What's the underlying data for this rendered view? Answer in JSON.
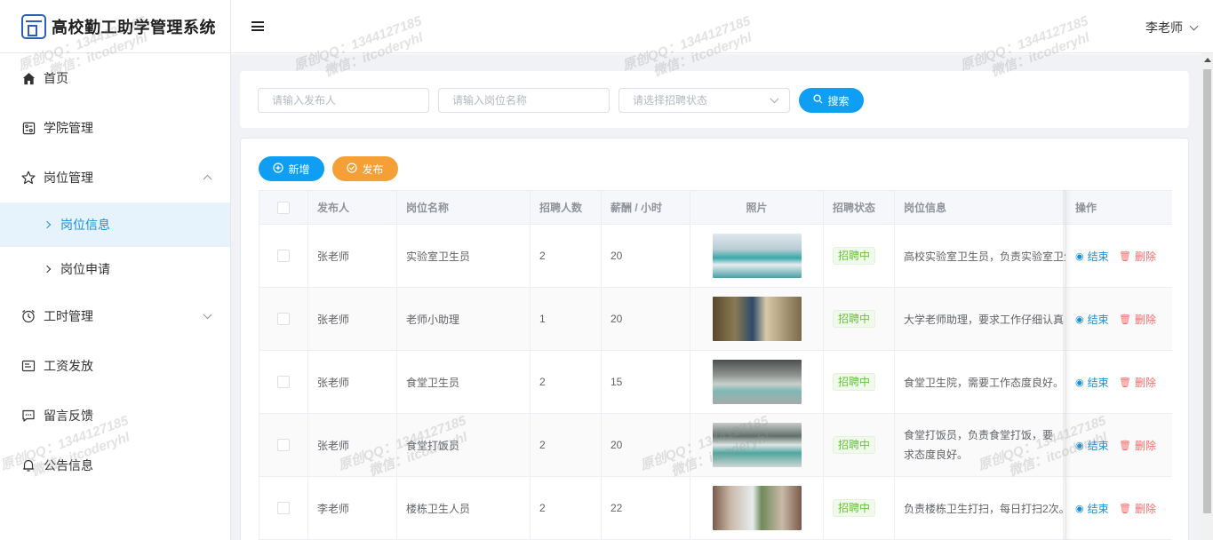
{
  "app": {
    "title": "高校勤工助学管理系统"
  },
  "header": {
    "user": "李老师"
  },
  "sidebar": {
    "items": [
      {
        "label": "首页",
        "icon": "home-icon"
      },
      {
        "label": "学院管理",
        "icon": "college-icon"
      },
      {
        "label": "岗位管理",
        "icon": "star-icon",
        "expanded": true,
        "children": [
          {
            "label": "岗位信息",
            "active": true
          },
          {
            "label": "岗位申请"
          }
        ]
      },
      {
        "label": "工时管理",
        "icon": "clock-icon",
        "expanded": false
      },
      {
        "label": "工资发放",
        "icon": "card-icon"
      },
      {
        "label": "留言反馈",
        "icon": "message-icon"
      },
      {
        "label": "公告信息",
        "icon": "bell-icon"
      }
    ]
  },
  "search": {
    "publisher_placeholder": "请输入发布人",
    "job_placeholder": "请输入岗位名称",
    "status_placeholder": "请选择招聘状态",
    "search_label": "搜索"
  },
  "toolbar": {
    "add_label": "新增",
    "publish_label": "发布"
  },
  "table": {
    "columns": [
      "发布人",
      "岗位名称",
      "招聘人数",
      "薪酬 / 小时",
      "照片",
      "招聘状态",
      "岗位信息",
      "操作"
    ],
    "actions": {
      "end": "结束",
      "delete": "删除"
    },
    "rows": [
      {
        "publisher": "张老师",
        "job": "实验室卫生员",
        "count": "2",
        "pay": "20",
        "status": "招聘中",
        "info": "高校实验室卫生员，负责实验室卫生",
        "photo": "lab-photo"
      },
      {
        "publisher": "张老师",
        "job": "老师小助理",
        "count": "1",
        "pay": "20",
        "status": "招聘中",
        "info": "大学老师助理，要求工作仔细认真",
        "photo": "library-photo"
      },
      {
        "publisher": "张老师",
        "job": "食堂卫生员",
        "count": "2",
        "pay": "15",
        "status": "招聘中",
        "info": "食堂卫生院，需要工作态度良好。",
        "photo": "canteen-photo"
      },
      {
        "publisher": "张老师",
        "job": "食堂打饭员",
        "count": "2",
        "pay": "20",
        "status": "招聘中",
        "info": "食堂打饭员，负责食堂打饭，要求态度良好。",
        "photo": "canteen-hall-photo"
      },
      {
        "publisher": "李老师",
        "job": "楼栋卫生人员",
        "count": "2",
        "pay": "22",
        "status": "招聘中",
        "info": "负责楼栋卫生打扫，每日打扫2次。",
        "photo": "building-photo"
      }
    ]
  },
  "watermark": {
    "line1": "原创QQ：1344127185",
    "line2": "微信：itcoderyhl"
  },
  "colors": {
    "accent": "#0f9ef3",
    "orange": "#f5a036",
    "success": "#67c23a",
    "danger": "#f56c6c"
  }
}
